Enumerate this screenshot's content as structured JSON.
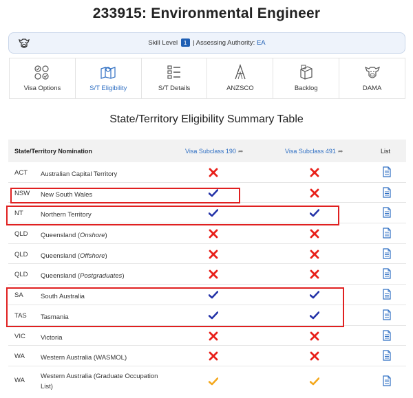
{
  "page": {
    "title": "233915: Environmental Engineer"
  },
  "skill_bar": {
    "skill_level_label": "Skill Level",
    "skill_level_value": "1",
    "separator": "|",
    "authority_label": "Assessing Authority:",
    "authority_value": "EA"
  },
  "tabs": [
    {
      "label": "Visa Options",
      "icon": "checklist-icon",
      "active": false
    },
    {
      "label": "S/T Eligibility",
      "icon": "map-icon",
      "active": true
    },
    {
      "label": "S/T Details",
      "icon": "list-details-icon",
      "active": false
    },
    {
      "label": "ANZSCO",
      "icon": "anzsco-a-icon",
      "active": false
    },
    {
      "label": "Backlog",
      "icon": "boxes-icon",
      "active": false
    },
    {
      "label": "DAMA",
      "icon": "cow-icon",
      "active": false
    }
  ],
  "section_title": "State/Territory Eligibility Summary Table",
  "table": {
    "headers": {
      "nomination": "State/Territory Nomination",
      "subclass190": "Visa Subclass 190",
      "subclass491": "Visa Subclass 491",
      "list": "List"
    },
    "rows": [
      {
        "code": "ACT",
        "name": "Australian Capital Territory",
        "note": "",
        "v190": "cross",
        "v491": "cross"
      },
      {
        "code": "NSW",
        "name": "New South Wales",
        "note": "",
        "v190": "check",
        "v491": "cross"
      },
      {
        "code": "NT",
        "name": "Northern Territory",
        "note": "",
        "v190": "check",
        "v491": "check"
      },
      {
        "code": "QLD",
        "name": "Queensland (",
        "note": "Onshore",
        "v190": "cross",
        "v491": "cross"
      },
      {
        "code": "QLD",
        "name": "Queensland (",
        "note": "Offshore",
        "v190": "cross",
        "v491": "cross"
      },
      {
        "code": "QLD",
        "name": "Queensland (",
        "note": "Postgraduates",
        "v190": "cross",
        "v491": "cross"
      },
      {
        "code": "SA",
        "name": "South Australia",
        "note": "",
        "v190": "check",
        "v491": "check"
      },
      {
        "code": "TAS",
        "name": "Tasmania",
        "note": "",
        "v190": "check",
        "v491": "check"
      },
      {
        "code": "VIC",
        "name": "Victoria",
        "note": "",
        "v190": "cross",
        "v491": "cross"
      },
      {
        "code": "WA",
        "name": "Western Australia (WASMOL)",
        "note": "",
        "v190": "cross",
        "v491": "cross"
      },
      {
        "code": "WA",
        "name": "Western Australia (Graduate Occupation List)",
        "note": "",
        "v190": "partial",
        "v491": "partial"
      }
    ]
  },
  "colors": {
    "check": "#2433a8",
    "cross": "#e8201a",
    "partial": "#f4a81d",
    "link": "#2f6fc3",
    "highlight": "#e02020"
  }
}
